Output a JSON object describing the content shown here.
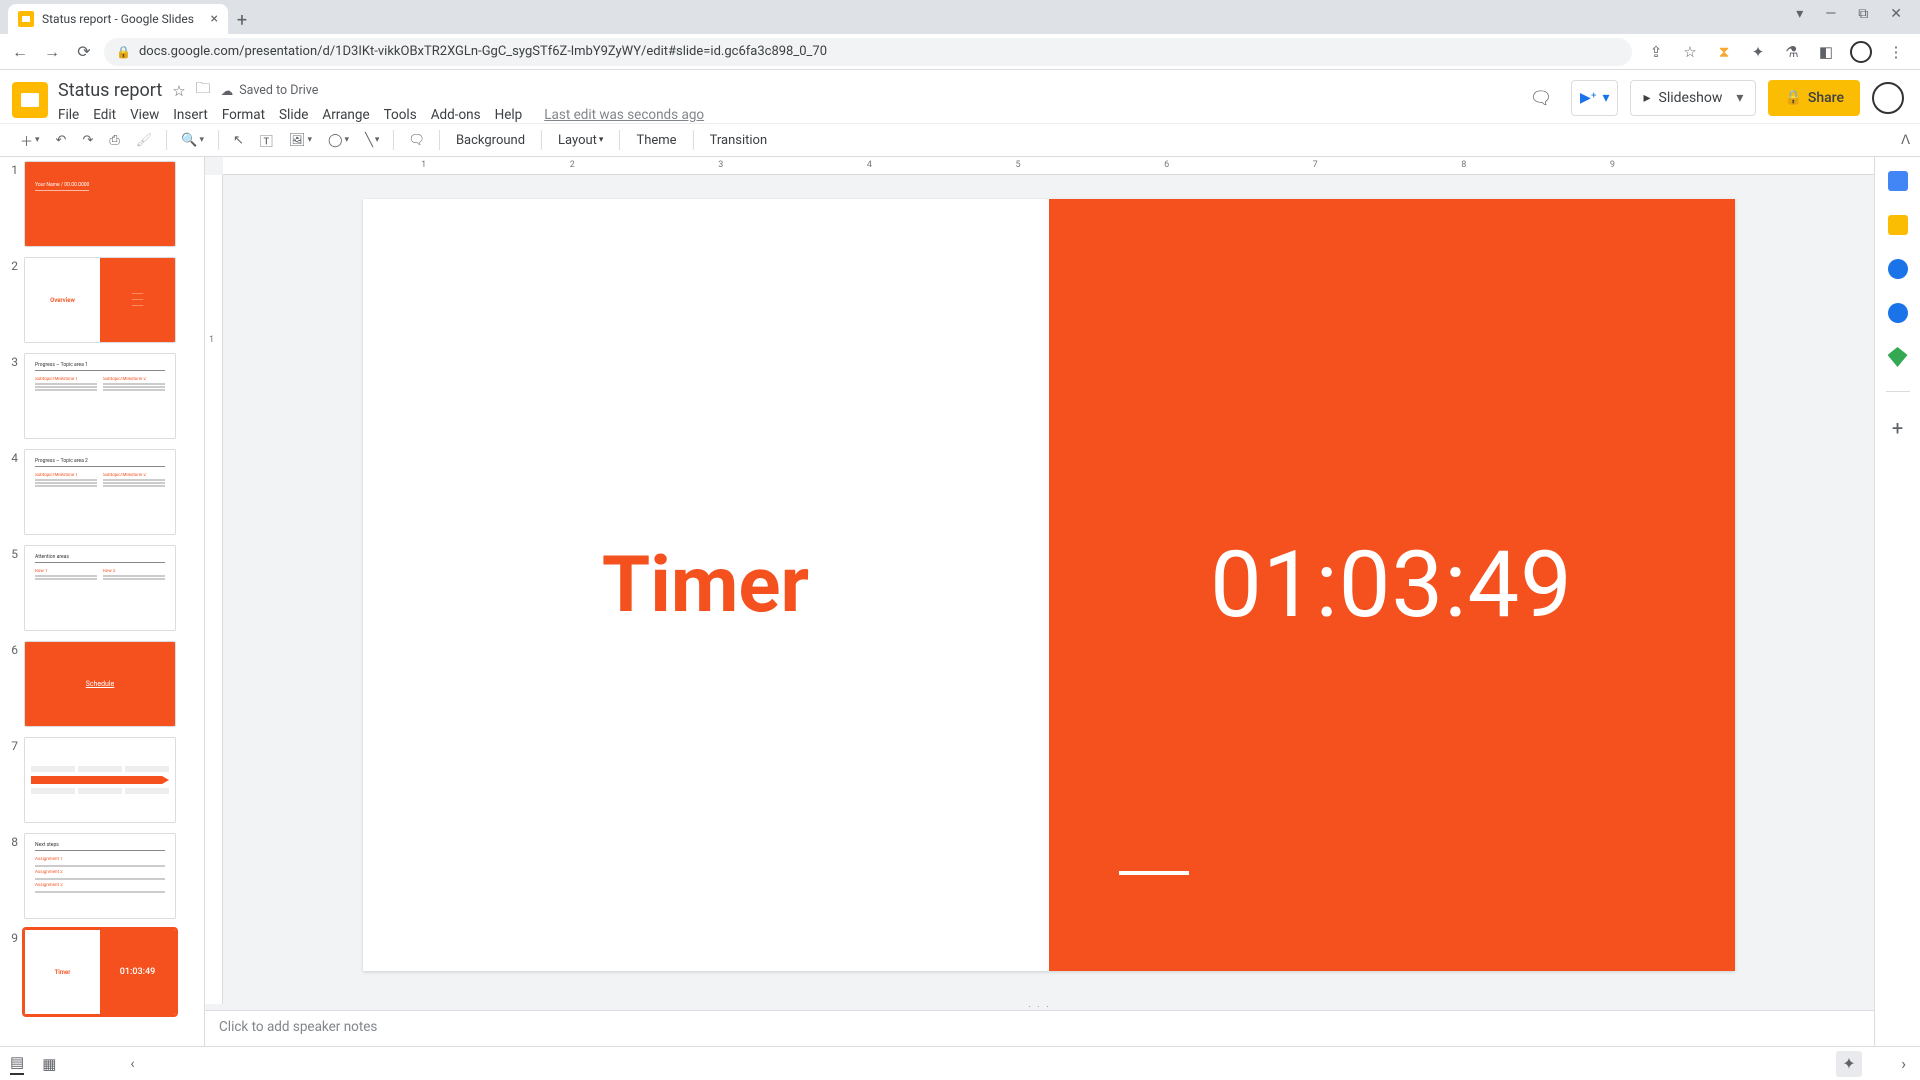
{
  "browser": {
    "tab_title": "Status report - Google Slides",
    "url": "docs.google.com/presentation/d/1D3IKt-vikkOBxTR2XGLn-GgC_sygSTf6Z-lmbY9ZyWY/edit#slide=id.gc6fa3c898_0_70"
  },
  "doc": {
    "title": "Status report",
    "saved_status": "Saved to Drive",
    "last_edit": "Last edit was seconds ago"
  },
  "menu": {
    "file": "File",
    "edit": "Edit",
    "view": "View",
    "insert": "Insert",
    "format": "Format",
    "slide": "Slide",
    "arrange": "Arrange",
    "tools": "Tools",
    "addons": "Add-ons",
    "help": "Help"
  },
  "header_buttons": {
    "slideshow": "Slideshow",
    "share": "Share"
  },
  "toolbar": {
    "background": "Background",
    "layout": "Layout",
    "theme": "Theme",
    "transition": "Transition"
  },
  "filmstrip": [
    {
      "n": "1",
      "type": "full-orange",
      "label": ""
    },
    {
      "n": "2",
      "type": "half",
      "left": "Overview",
      "right": ""
    },
    {
      "n": "3",
      "type": "text2col",
      "title": "Progress – Topic area 1"
    },
    {
      "n": "4",
      "type": "text2col",
      "title": "Progress – Topic area 2"
    },
    {
      "n": "5",
      "type": "text2col",
      "title": "Attention areas"
    },
    {
      "n": "6",
      "type": "orange-title",
      "title": "Schedule"
    },
    {
      "n": "7",
      "type": "timeline",
      "title": ""
    },
    {
      "n": "8",
      "type": "textlist",
      "title": "Next steps"
    },
    {
      "n": "9",
      "type": "timer-thumb",
      "left": "Timer",
      "right": "01:03:49"
    }
  ],
  "current_slide": {
    "title": "Timer",
    "timer_value": "01:03:49"
  },
  "speaker_notes_placeholder": "Click to add speaker notes",
  "ruler_h": [
    "1",
    "2",
    "3",
    "4",
    "5",
    "6",
    "7",
    "8",
    "9"
  ],
  "ruler_v": [
    "1"
  ]
}
